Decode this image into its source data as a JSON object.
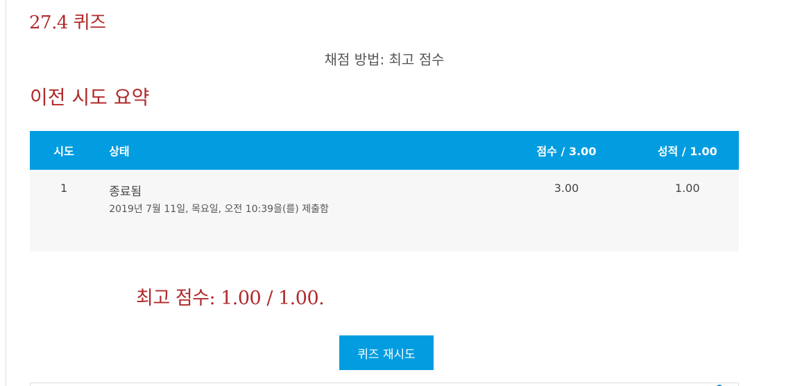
{
  "quiz": {
    "title": "27.4 퀴즈",
    "grading_method": "채점 방법: 최고 점수"
  },
  "summary": {
    "heading": "이전 시도 요약",
    "columns": {
      "attempt": "시도",
      "status": "상태",
      "marks": "점수 / 3.00",
      "grade": "성적 / 1.00"
    },
    "rows": [
      {
        "attempt": "1",
        "status": "종료됨",
        "submitted": "2019년 7월 11일, 목요일, 오전 10:39을(를) 제출함",
        "marks": "3.00",
        "grade": "1.00"
      }
    ]
  },
  "result": {
    "highest_grade": "최고 점수: 1.00 / 1.00."
  },
  "actions": {
    "retry_label": "퀴즈 재시도"
  },
  "colors": {
    "accent_red": "#b0292b",
    "header_blue": "#029de0",
    "row_bg": "#f7f7f7"
  }
}
